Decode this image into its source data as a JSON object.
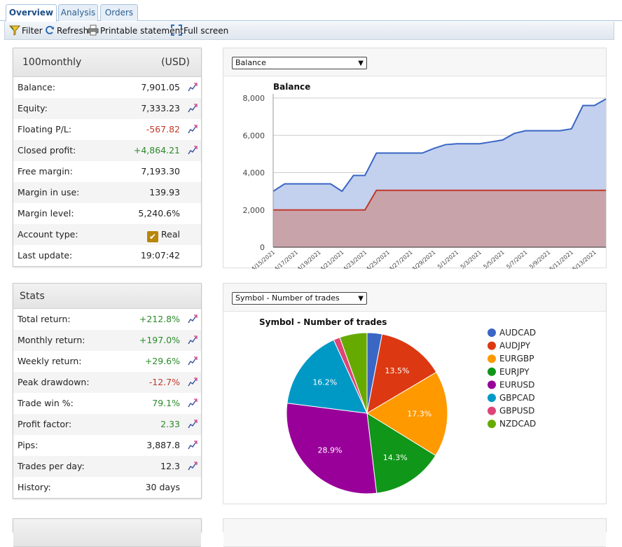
{
  "tabs": [
    {
      "label": "Overview",
      "active": true
    },
    {
      "label": "Analysis",
      "active": false
    },
    {
      "label": "Orders",
      "active": false
    }
  ],
  "toolbar": {
    "filter": "Filter",
    "refresh": "Refresh",
    "printable": "Printable statement",
    "fullscreen": "Full screen"
  },
  "account": {
    "name": "100monthly",
    "currency": "(USD)",
    "rows": [
      {
        "label": "Balance:",
        "value": "7,901.05",
        "tone": "",
        "chart": true
      },
      {
        "label": "Equity:",
        "value": "7,333.23",
        "tone": "",
        "chart": true
      },
      {
        "label": "Floating P/L:",
        "value": "-567.82",
        "tone": "neg",
        "chart": true
      },
      {
        "label": "Closed profit:",
        "value": "+4,864.21",
        "tone": "pos",
        "chart": true
      },
      {
        "label": "Free margin:",
        "value": "7,193.30",
        "tone": "",
        "chart": false
      },
      {
        "label": "Margin in use:",
        "value": "139.93",
        "tone": "",
        "chart": false
      },
      {
        "label": "Margin level:",
        "value": "5,240.6%",
        "tone": "",
        "chart": false
      },
      {
        "label": "Account type:",
        "value": "Real",
        "tone": "",
        "chart": false,
        "checkbox": true
      },
      {
        "label": "Last update:",
        "value": "19:07:42",
        "tone": "",
        "chart": false
      }
    ]
  },
  "stats": {
    "title": "Stats",
    "rows": [
      {
        "label": "Total return:",
        "value": "+212.8%",
        "tone": "pos",
        "chart": true
      },
      {
        "label": "Monthly return:",
        "value": "+197.0%",
        "tone": "pos",
        "chart": true
      },
      {
        "label": "Weekly return:",
        "value": "+29.6%",
        "tone": "pos",
        "chart": true
      },
      {
        "label": "Peak drawdown:",
        "value": "-12.7%",
        "tone": "neg",
        "chart": true
      },
      {
        "label": "Trade win %:",
        "value": "79.1%",
        "tone": "pos",
        "chart": true
      },
      {
        "label": "Profit factor:",
        "value": "2.33",
        "tone": "pos",
        "chart": true
      },
      {
        "label": "Pips:",
        "value": "3,887.8",
        "tone": "",
        "chart": true
      },
      {
        "label": "Trades per day:",
        "value": "12.3",
        "tone": "",
        "chart": true
      },
      {
        "label": "History:",
        "value": "30 days",
        "tone": "",
        "chart": false
      }
    ]
  },
  "balance_select": "Balance",
  "symbol_select": "Symbol - Number of trades",
  "colors": {
    "balance_line": "#3a66c4",
    "balance_fill": "#c3d1ee",
    "deposit_line": "#c0392b",
    "deposit_fill": "#c9a3aa"
  },
  "chart_data": [
    {
      "type": "area",
      "title": "Balance",
      "ylim": [
        0,
        8000
      ],
      "yticks": [
        "0",
        "2,000",
        "4,000",
        "6,000",
        "8,000"
      ],
      "xticks": [
        "4/15/2021",
        "4/17/2021",
        "4/19/2021",
        "4/21/2021",
        "4/23/2021",
        "4/25/2021",
        "4/27/2021",
        "4/29/2021",
        "5/1/2021",
        "5/3/2021",
        "5/5/2021",
        "5/7/2021",
        "5/9/2021",
        "5/11/2021",
        "5/13/2021"
      ],
      "grid": true,
      "series": [
        {
          "x": [
            "4/15/2021",
            "4/16/2021",
            "4/17/2021",
            "4/18/2021",
            "4/19/2021",
            "4/20/2021",
            "4/21/2021",
            "4/22/2021",
            "4/23/2021",
            "4/24/2021",
            "4/25/2021",
            "4/26/2021",
            "4/27/2021",
            "4/28/2021",
            "4/29/2021",
            "4/30/2021",
            "5/1/2021",
            "5/2/2021",
            "5/3/2021",
            "5/4/2021",
            "5/5/2021",
            "5/6/2021",
            "5/7/2021",
            "5/8/2021",
            "5/9/2021",
            "5/10/2021",
            "5/11/2021",
            "5/12/2021",
            "5/13/2021",
            "5/14/2021"
          ],
          "values": [
            3000,
            3400,
            3400,
            3400,
            3400,
            3400,
            3000,
            3850,
            3850,
            5050,
            5050,
            5050,
            5050,
            5050,
            5300,
            5500,
            5550,
            5550,
            5550,
            5650,
            5750,
            6100,
            6250,
            6250,
            6250,
            6250,
            6350,
            7600,
            7600,
            7950
          ]
        },
        {
          "x": [
            "4/15/2021",
            "4/23/2021",
            "4/24/2021",
            "5/14/2021"
          ],
          "values": [
            2000,
            2000,
            3050,
            3050
          ]
        }
      ]
    },
    {
      "type": "pie",
      "title": "Symbol - Number of trades",
      "labels": [
        "AUDCAD",
        "AUDJPY",
        "EURGBP",
        "EURJPY",
        "EURUSD",
        "GBPCAD",
        "GBPUSD",
        "NZDCAD"
      ],
      "values": [
        3.0,
        13.5,
        17.3,
        14.3,
        28.9,
        16.2,
        1.3,
        5.5
      ],
      "data_labels": [
        "",
        "13.5%",
        "17.3%",
        "14.3%",
        "28.9%",
        "16.2%",
        "",
        ""
      ],
      "colors": [
        "#3a66c4",
        "#dc3912",
        "#ff9900",
        "#109618",
        "#990099",
        "#0099c6",
        "#dd4477",
        "#66aa00"
      ],
      "legend": "right"
    }
  ]
}
